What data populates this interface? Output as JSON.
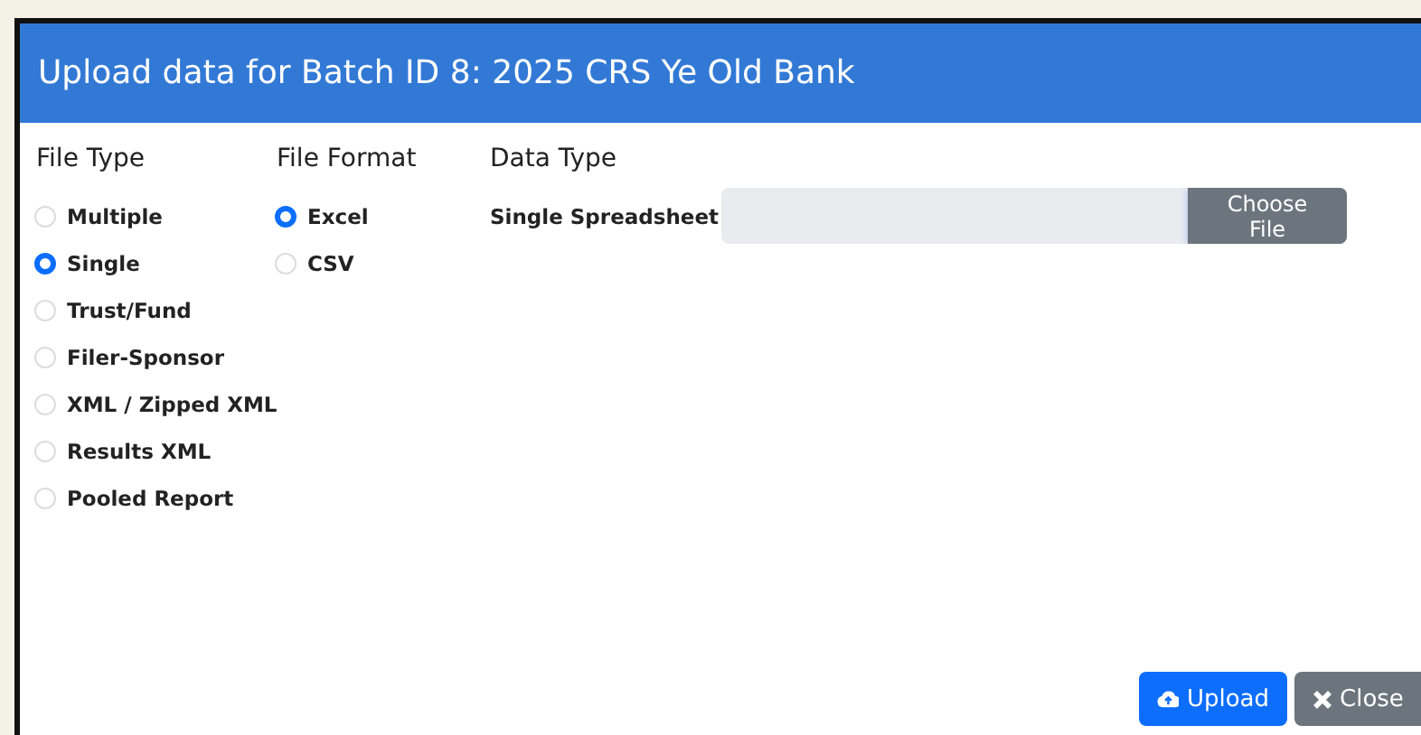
{
  "dialog": {
    "title": "Upload data for Batch ID 8: 2025 CRS Ye Old Bank"
  },
  "file_type": {
    "label": "File Type",
    "options": [
      {
        "label": "Multiple",
        "selected": false
      },
      {
        "label": "Single",
        "selected": true
      },
      {
        "label": "Trust/Fund",
        "selected": false
      },
      {
        "label": "Filer-Sponsor",
        "selected": false
      },
      {
        "label": "XML / Zipped XML",
        "selected": false
      },
      {
        "label": "Results XML",
        "selected": false
      },
      {
        "label": "Pooled Report",
        "selected": false
      }
    ]
  },
  "file_format": {
    "label": "File Format",
    "options": [
      {
        "label": "Excel",
        "selected": true
      },
      {
        "label": "CSV",
        "selected": false
      }
    ]
  },
  "data_type": {
    "label": "Data Type",
    "field_label": "Single Spreadsheet",
    "button": "Choose File"
  },
  "buttons": [
    {
      "kind": "upload",
      "label": "Upload"
    },
    {
      "kind": "close",
      "label": "Close"
    }
  ]
}
